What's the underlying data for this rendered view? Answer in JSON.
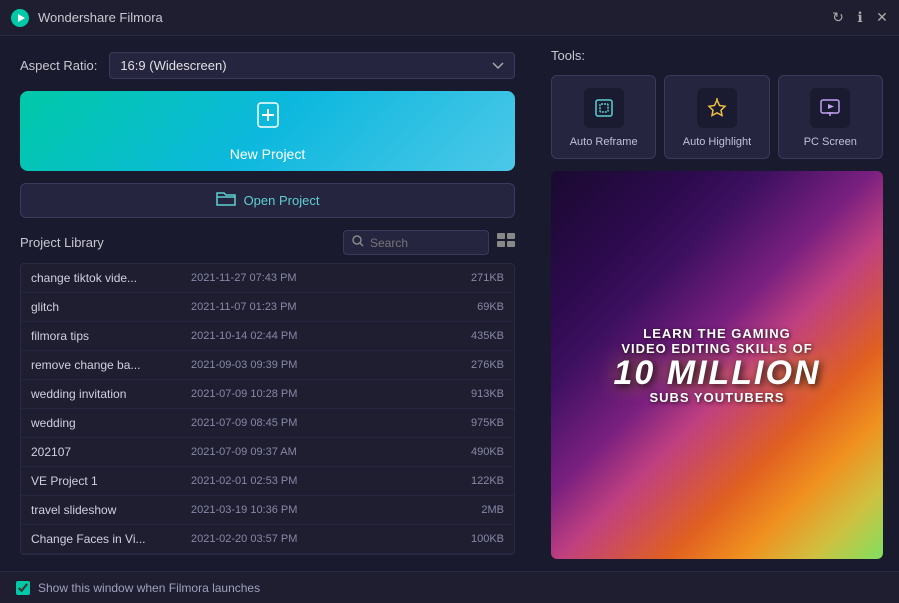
{
  "app": {
    "title": "Wondershare Filmora",
    "logo_char": "🎬"
  },
  "window_controls": {
    "refresh_label": "↻",
    "info_label": "ℹ",
    "close_label": "✕"
  },
  "left_panel": {
    "aspect_ratio_label": "Aspect Ratio:",
    "aspect_ratio_value": "16:9 (Widescreen)",
    "new_project_label": "New Project",
    "new_project_icon": "＋",
    "open_project_label": "Open Project",
    "open_icon": "📁"
  },
  "library": {
    "title": "Project Library",
    "search_placeholder": "Search",
    "projects": [
      {
        "name": "change tiktok vide...",
        "date": "2021-11-27 07:43 PM",
        "size": "271KB"
      },
      {
        "name": "glitch",
        "date": "2021-11-07 01:23 PM",
        "size": "69KB"
      },
      {
        "name": "filmora tips",
        "date": "2021-10-14 02:44 PM",
        "size": "435KB"
      },
      {
        "name": "remove change ba...",
        "date": "2021-09-03 09:39 PM",
        "size": "276KB"
      },
      {
        "name": "wedding invitation",
        "date": "2021-07-09 10:28 PM",
        "size": "913KB"
      },
      {
        "name": "wedding",
        "date": "2021-07-09 08:45 PM",
        "size": "975KB"
      },
      {
        "name": "202107",
        "date": "2021-07-09 09:37 AM",
        "size": "490KB"
      },
      {
        "name": "VE Project 1",
        "date": "2021-02-01 02:53 PM",
        "size": "122KB"
      },
      {
        "name": "travel slideshow",
        "date": "2021-03-19 10:36 PM",
        "size": "2MB"
      },
      {
        "name": "Change Faces in Vi...",
        "date": "2021-02-20 03:57 PM",
        "size": "100KB"
      }
    ]
  },
  "tools": {
    "label": "Tools:",
    "items": [
      {
        "id": "auto-reframe",
        "label": "Auto Reframe",
        "icon": "⊡"
      },
      {
        "id": "auto-highlight",
        "label": "Auto Highlight",
        "icon": "⚡"
      },
      {
        "id": "pc-screen",
        "label": "PC Screen",
        "icon": "▶"
      }
    ]
  },
  "banner": {
    "line1": "LEARN THE GAMING",
    "line2": "VIDEO EDITING SKILLS OF",
    "million": "10 MILLION",
    "line3": "SUBS YOUTUBERS"
  },
  "bottom_bar": {
    "checkbox_label": "Show this window when Filmora launches",
    "checked": true
  }
}
